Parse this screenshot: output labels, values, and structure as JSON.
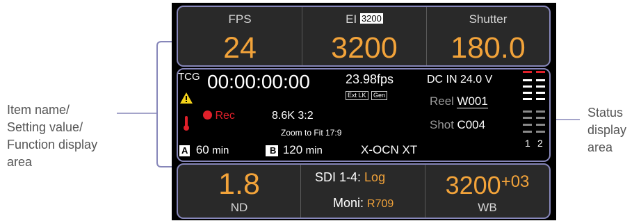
{
  "callouts": {
    "left_lines": [
      "Item name/",
      "Setting value/",
      "Function display",
      "area"
    ],
    "right_lines": [
      "Status",
      "display",
      "area"
    ]
  },
  "top": {
    "fps": {
      "label": "FPS",
      "value": "24"
    },
    "ei": {
      "label": "EI",
      "badge": "3200",
      "value": "3200"
    },
    "shutter": {
      "label": "Shutter",
      "value": "180.0"
    }
  },
  "status": {
    "tcg": "TCG",
    "timecode": "00:00:00:00",
    "fps": "23.98fps",
    "ext_lk": "Ext LK",
    "gen": "Gen",
    "dc_in": "DC IN 24.0 V",
    "rec": "Rec",
    "resolution": "8.6K 3:2",
    "zoom": "Zoom to Fit 17:9",
    "reel_label": "Reel",
    "reel_value": "W001",
    "shot_label": "Shot",
    "shot_value": "C004",
    "slot_a": "A",
    "slot_a_time": "60",
    "slot_b": "B",
    "slot_b_time": "120",
    "unit": "min",
    "codec": "X-OCN XT",
    "meter_ch1": "1",
    "meter_ch2": "2"
  },
  "bottom": {
    "nd": {
      "value": "1.8",
      "label": "ND"
    },
    "sdi_label": "SDI 1-4:",
    "sdi_value": "Log",
    "moni_label": "Moni:",
    "moni_value": "R709",
    "wb": {
      "value": "3200",
      "offset": "+03",
      "label": "WB"
    }
  },
  "colors": {
    "accent": "#f2a33a",
    "frame": "#8686b9",
    "rec": "#e0202a",
    "warning": "#f5d31a"
  }
}
